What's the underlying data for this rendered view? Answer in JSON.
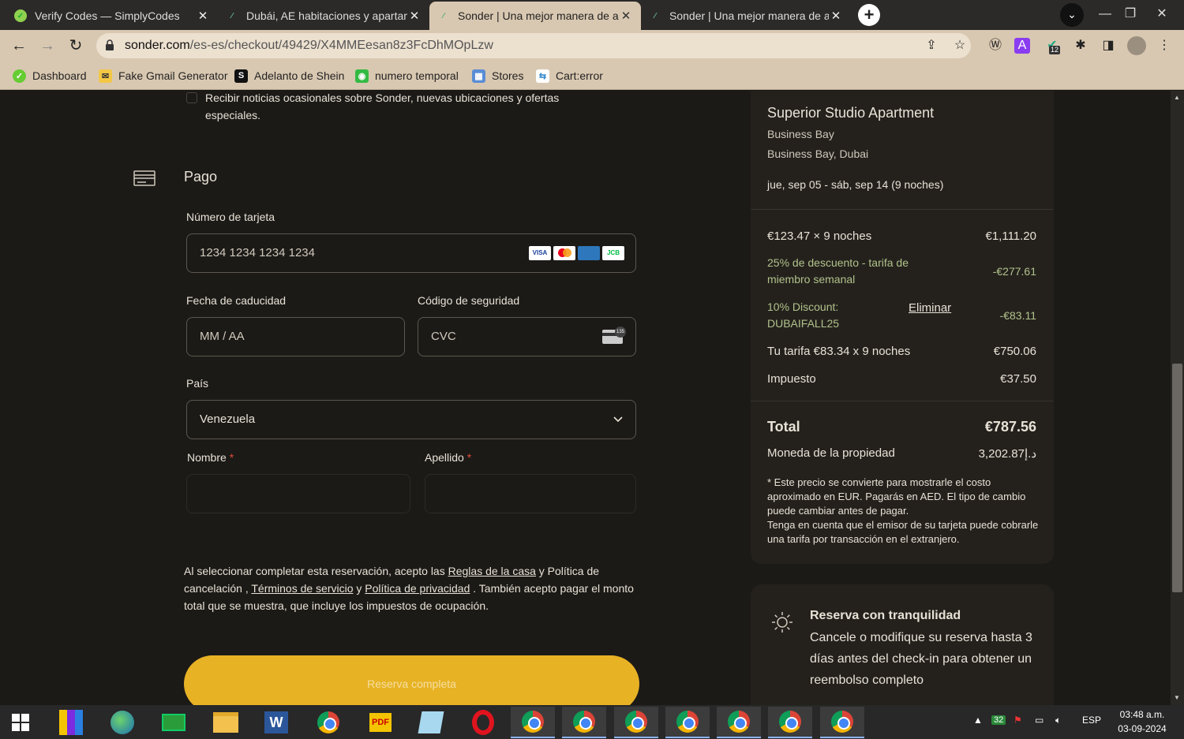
{
  "browser": {
    "tabs": [
      {
        "title": "Verify Codes — SimplyCodes",
        "favicon": "simplycodes-icon",
        "active": false
      },
      {
        "title": "Dubái, AE habitaciones y apartam",
        "favicon": "sonder-icon",
        "active": false
      },
      {
        "title": "Sonder | Una mejor manera de al",
        "favicon": "sonder-icon",
        "active": true
      },
      {
        "title": "Sonder | Una mejor manera de al",
        "favicon": "sonder-icon",
        "active": false
      }
    ],
    "new_tab": "+",
    "url_host": "sonder.com",
    "url_path": "/es-es/checkout/49429/X4MMEesan8z3FcDhMOpLzw",
    "extension_badge": "12",
    "bookmarks": [
      "Dashboard",
      "Fake Gmail Generator",
      "Adelanto de Shein",
      "numero temporal",
      "Stores",
      "Cart:error"
    ]
  },
  "form": {
    "newsletter": "Recibir noticias ocasionales sobre Sonder, nuevas ubicaciones y ofertas especiales.",
    "payment_title": "Pago",
    "card_label": "Número de tarjeta",
    "card_placeholder": "1234 1234 1234 1234",
    "card_brands": [
      "VISA",
      "MC",
      "AMEX",
      "JCB"
    ],
    "expiry_label": "Fecha de caducidad",
    "expiry_placeholder": "MM / AA",
    "cvc_label": "Código de seguridad",
    "cvc_placeholder": "CVC",
    "cvc_badge": "135",
    "country_label": "País",
    "country_value": "Venezuela",
    "first_name_label": "Nombre",
    "last_name_label": "Apellido",
    "required_mark": "*",
    "terms": {
      "t1": "Al seleccionar completar esta reservación, acepto las",
      "house_rules": "Reglas de la casa",
      "t2": "y Política de cancelación ,",
      "terms_of_service": "Términos de servicio",
      "t3": "y",
      "privacy": "Política de privacidad",
      "t4": ". También acepto pagar el monto total que se muestra, que incluye los impuestos de ocupación."
    },
    "submit_label": "Reserva completa"
  },
  "summary": {
    "property": "Superior Studio Apartment",
    "area": "Business Bay",
    "location": "Business Bay, Dubai",
    "dates": "jue, sep 05 - sáb, sep 14 (9 noches)",
    "nightly_label": "€123.47 × 9 noches",
    "nightly_value": "€1,111.20",
    "discount_label": "25% de descuento - tarifa de miembro semanal",
    "discount_value": "-€277.61",
    "code_label": "10% Discount: DUBAIFALL25",
    "code_remove": "Eliminar",
    "code_value": "-€83.11",
    "rate_label": "Tu tarifa €83.34 x 9 noches",
    "rate_value": "€750.06",
    "tax_label": "Impuesto",
    "tax_value": "€37.50",
    "total_label": "Total",
    "total_value": "€787.56",
    "currency_label": "Moneda de la propiedad",
    "currency_value": "3,202.87د.إ",
    "note": "* Este precio se convierte para mostrarle el costo aproximado en EUR. Pagarás en AED. El tipo de cambio puede cambiar antes de pagar.",
    "note2": "Tenga en cuenta que el emisor de su tarjeta puede cobrarle una tarifa por transacción en el extranjero."
  },
  "calm": {
    "title": "Reserva con tranquilidad",
    "body": "Cancele o modifique su reserva hasta 3 días antes del check-in para obtener un reembolso completo"
  },
  "taskbar": {
    "notif_count": "32",
    "lang": "ESP",
    "time": "03:48 a.m.",
    "date": "03-09-2024"
  },
  "colors": {
    "accent": "#e8b225",
    "green": "#b1c28a",
    "bg": "#1c1a17",
    "panel": "#24211d"
  }
}
